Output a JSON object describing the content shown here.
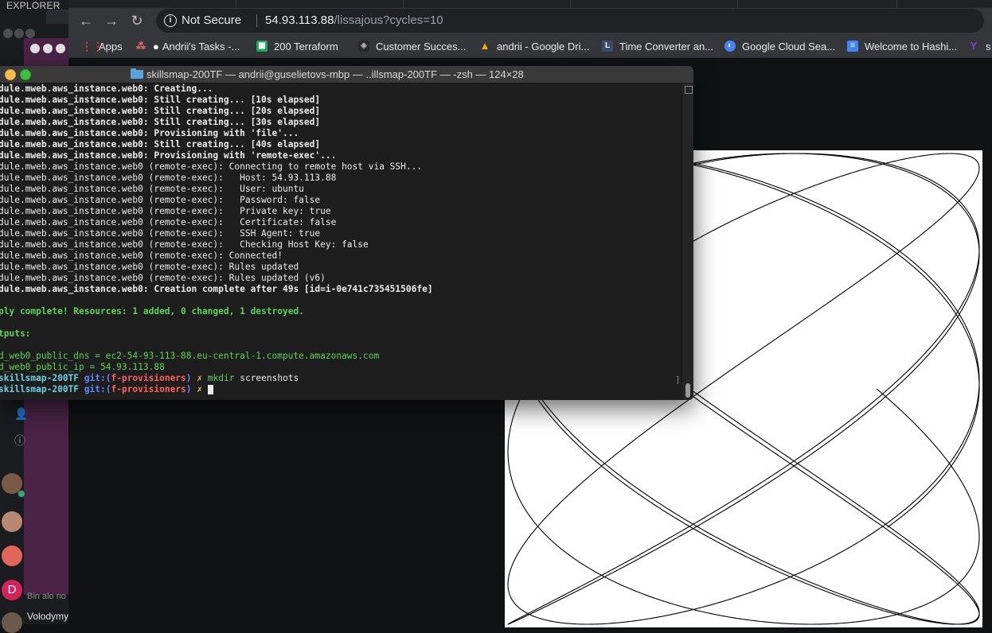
{
  "left_app": {
    "explorer_label": "EXPLORER",
    "bottom_faded": "Bin alo no",
    "bottom_name": "Volodymyr",
    "avatar_letter": "D"
  },
  "browser": {
    "address": {
      "security_label": "Not Secure",
      "host": "54.93.113.88",
      "path": "/lissajous?cycles=10"
    },
    "bookmarks": [
      {
        "label": "Apps",
        "icon": "apps-grid-icon"
      },
      {
        "label": "Andrii's Tasks -...",
        "icon": "asana-icon"
      },
      {
        "label": "200 Terraform",
        "icon": "sheets-icon"
      },
      {
        "label": "Customer Succes...",
        "icon": "hashicorp-icon"
      },
      {
        "label": "andrii - Google Dri...",
        "icon": "google-drive-icon"
      },
      {
        "label": "Time Converter an...",
        "icon": "time-converter-icon"
      },
      {
        "label": "Google Cloud Sea...",
        "icon": "google-cloud-icon"
      },
      {
        "label": "Welcome to Hashi...",
        "icon": "docs-icon"
      },
      {
        "label": "s",
        "icon": "yahoo-icon"
      }
    ],
    "page": {
      "content": "lissajous figure, cycles=10"
    }
  },
  "terminal": {
    "title": "skillsmap-200TF — andrii@guselietovs-mbp — ..illsmap-200TF — -zsh — 124×28",
    "lines": [
      "dule.mweb.aws_instance.web0: Creating...",
      "dule.mweb.aws_instance.web0: Still creating... [10s elapsed]",
      "dule.mweb.aws_instance.web0: Still creating... [20s elapsed]",
      "dule.mweb.aws_instance.web0: Still creating... [30s elapsed]",
      "dule.mweb.aws_instance.web0: Provisioning with 'file'...",
      "dule.mweb.aws_instance.web0: Still creating... [40s elapsed]",
      "dule.mweb.aws_instance.web0: Provisioning with 'remote-exec'...",
      "dule.mweb.aws_instance.web0 (remote-exec): Connecting to remote host via SSH...",
      "dule.mweb.aws_instance.web0 (remote-exec):   Host: 54.93.113.88",
      "dule.mweb.aws_instance.web0 (remote-exec):   User: ubuntu",
      "dule.mweb.aws_instance.web0 (remote-exec):   Password: false",
      "dule.mweb.aws_instance.web0 (remote-exec):   Private key: true",
      "dule.mweb.aws_instance.web0 (remote-exec):   Certificate: false",
      "dule.mweb.aws_instance.web0 (remote-exec):   SSH Agent: true",
      "dule.mweb.aws_instance.web0 (remote-exec):   Checking Host Key: false",
      "dule.mweb.aws_instance.web0 (remote-exec): Connected!",
      "dule.mweb.aws_instance.web0 (remote-exec): Rules updated",
      "dule.mweb.aws_instance.web0 (remote-exec): Rules updated (v6)",
      "dule.mweb.aws_instance.web0: Creation complete after 49s [id=i-0e741c735451506fe]",
      "",
      "ply complete! Resources: 1 added, 0 changed, 1 destroyed.",
      "",
      "tputs:",
      "",
      "d_web0_public_dns = ec2-54-93-113-88.eu-central-1.compute.amazonaws.com",
      "d_web0_public_ip = 54.93.113.88"
    ],
    "prompt1": {
      "dir": "skillsmap-200TF",
      "git_label": "git:(",
      "branch": "f-provisioners",
      "git_close": ")",
      "mark": "✗",
      "cmd": "mkdir",
      "arg": "screenshots"
    },
    "prompt2": {
      "dir": "skillsmap-200TF",
      "git_label": "git:(",
      "branch": "f-provisioners",
      "git_close": ")",
      "mark": "✗"
    }
  }
}
